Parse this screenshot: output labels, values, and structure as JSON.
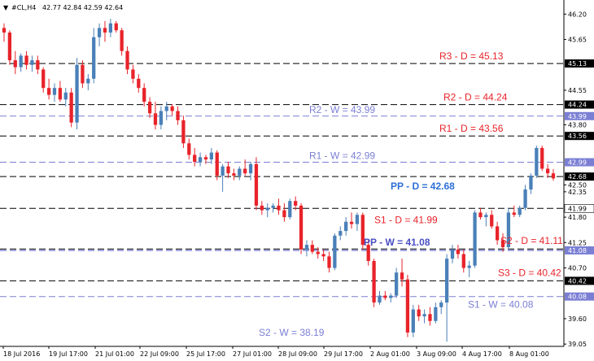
{
  "header": {
    "arrow": "▼",
    "symbol": "#CL,H4",
    "ohlc": "42.77 42.84 42.59 42.64"
  },
  "chart_data": {
    "type": "candlestick",
    "title": "#CL,H4",
    "y_ticks": [
      "46.20",
      "45.65",
      "44.55",
      "43.80",
      "42.50",
      "42.35",
      "41.80",
      "41.25",
      "40.70",
      "39.60",
      "39.05",
      "41.99",
      "41.08",
      "40.08"
    ],
    "x_ticks": [
      "18 Jul 2016",
      "19 Jul 17:00",
      "21 Jul 01:00",
      "22 Jul 09:00",
      "25 Jul 17:00",
      "27 Jul 01:00",
      "28 Jul 09:00",
      "29 Jul 17:00",
      "2 Aug 01:00",
      "3 Aug 09:00",
      "4 Aug 17:00",
      "8 Aug 01:00"
    ],
    "ylim": [
      39.0,
      46.4
    ],
    "pivot_levels": [
      {
        "label": "R3 - D = 45.13",
        "value": 45.13,
        "badge": "45.13",
        "color": "#e8232a",
        "line_color": "#000000",
        "badge_bg": "#000000",
        "badge_fg": "#ffffff",
        "bold": false
      },
      {
        "label": "R2 - D = 44.24",
        "value": 44.24,
        "badge": "44.24",
        "color": "#e8232a",
        "line_color": "#000000",
        "badge_bg": "#000000",
        "badge_fg": "#ffffff",
        "bold": false
      },
      {
        "label": "R2 - W = 43.99",
        "value": 43.99,
        "badge": "43.99",
        "color": "#7b7fd4",
        "line_color": "#7b7fd4",
        "badge_bg": "#7b7fd4",
        "badge_fg": "#ffffff",
        "bold": false
      },
      {
        "label": "R1 - D = 43.56",
        "value": 43.56,
        "badge": "43.56",
        "color": "#e8232a",
        "line_color": "#000000",
        "badge_bg": "#000000",
        "badge_fg": "#ffffff",
        "bold": false
      },
      {
        "label": "R1 - W = 42.99",
        "value": 42.99,
        "badge": "42.99",
        "color": "#7b7fd4",
        "line_color": "#7b7fd4",
        "badge_bg": "#7b7fd4",
        "badge_fg": "#ffffff",
        "bold": false
      },
      {
        "label": "PP - D = 42.68",
        "value": 42.68,
        "badge": "42.68",
        "color": "#2d6fd6",
        "line_color": "#000000",
        "badge_bg": "#000000",
        "badge_fg": "#ffffff",
        "bold": true
      },
      {
        "label": "S1 - D = 41.99",
        "value": 41.99,
        "badge": "41.99",
        "color": "#e8232a",
        "line_color": "#000000",
        "badge_bg": "#ffffff",
        "badge_fg": "#000000",
        "bold": false
      },
      {
        "label": "S2 - D = 41.11",
        "value": 41.11,
        "badge": "",
        "color": "#e8232a",
        "line_color": "#000000",
        "badge_bg": "#000000",
        "badge_fg": "#ffffff",
        "bold": false
      },
      {
        "label": "PP - W = 41.08",
        "value": 41.08,
        "badge": "41.08",
        "color": "#4a4fc4",
        "line_color": "#4a4fc4",
        "badge_bg": "#7b7fd4",
        "badge_fg": "#ffffff",
        "bold": true
      },
      {
        "label": "S3 - D = 40.42",
        "value": 40.42,
        "badge": "40.42",
        "color": "#e8232a",
        "line_color": "#000000",
        "badge_bg": "#000000",
        "badge_fg": "#ffffff",
        "bold": false
      },
      {
        "label": "S1 - W = 40.08",
        "value": 40.08,
        "badge": "40.08",
        "color": "#7b7fd4",
        "line_color": "#7b7fd4",
        "badge_bg": "#7b7fd4",
        "badge_fg": "#ffffff",
        "bold": false
      },
      {
        "label": "S2 - W = 38.19",
        "value": 38.19,
        "badge": "",
        "color": "#7b7fd4",
        "line_color": "#7b7fd4",
        "badge_bg": "",
        "badge_fg": "",
        "bold": false
      }
    ],
    "colors": {
      "bull": "#4a80b8",
      "bear": "#e8232a",
      "axis": "#000000",
      "bull_badge": "#000000"
    },
    "candles": [
      {
        "o": 45.9,
        "h": 46.0,
        "l": 45.6,
        "c": 45.8
      },
      {
        "o": 45.8,
        "h": 45.85,
        "l": 45.1,
        "c": 45.2
      },
      {
        "o": 45.2,
        "h": 45.4,
        "l": 44.9,
        "c": 45.05
      },
      {
        "o": 45.05,
        "h": 45.35,
        "l": 44.95,
        "c": 45.3
      },
      {
        "o": 45.3,
        "h": 45.4,
        "l": 45.0,
        "c": 45.1
      },
      {
        "o": 45.1,
        "h": 45.3,
        "l": 44.95,
        "c": 45.2
      },
      {
        "o": 45.2,
        "h": 45.3,
        "l": 44.9,
        "c": 45.0
      },
      {
        "o": 45.0,
        "h": 45.05,
        "l": 44.5,
        "c": 44.6
      },
      {
        "o": 44.6,
        "h": 44.8,
        "l": 44.35,
        "c": 44.45
      },
      {
        "o": 44.45,
        "h": 44.7,
        "l": 44.3,
        "c": 44.6
      },
      {
        "o": 44.6,
        "h": 44.75,
        "l": 44.3,
        "c": 44.35
      },
      {
        "o": 44.35,
        "h": 44.6,
        "l": 44.2,
        "c": 44.5
      },
      {
        "o": 44.5,
        "h": 44.6,
        "l": 43.75,
        "c": 43.85
      },
      {
        "o": 43.85,
        "h": 45.25,
        "l": 43.7,
        "c": 45.1
      },
      {
        "o": 45.1,
        "h": 45.2,
        "l": 44.6,
        "c": 44.7
      },
      {
        "o": 44.7,
        "h": 44.9,
        "l": 44.55,
        "c": 44.8
      },
      {
        "o": 44.8,
        "h": 45.9,
        "l": 44.7,
        "c": 45.7
      },
      {
        "o": 45.7,
        "h": 46.0,
        "l": 45.5,
        "c": 45.9
      },
      {
        "o": 45.9,
        "h": 46.05,
        "l": 45.6,
        "c": 45.8
      },
      {
        "o": 45.8,
        "h": 46.1,
        "l": 45.7,
        "c": 46.0
      },
      {
        "o": 46.0,
        "h": 46.05,
        "l": 45.8,
        "c": 45.85
      },
      {
        "o": 45.85,
        "h": 45.9,
        "l": 45.3,
        "c": 45.4
      },
      {
        "o": 45.4,
        "h": 45.5,
        "l": 44.9,
        "c": 45.0
      },
      {
        "o": 45.0,
        "h": 45.1,
        "l": 44.7,
        "c": 44.8
      },
      {
        "o": 44.8,
        "h": 44.9,
        "l": 44.5,
        "c": 44.6
      },
      {
        "o": 44.6,
        "h": 44.7,
        "l": 44.2,
        "c": 44.3
      },
      {
        "o": 44.3,
        "h": 44.4,
        "l": 43.95,
        "c": 44.05
      },
      {
        "o": 44.05,
        "h": 44.3,
        "l": 43.7,
        "c": 43.8
      },
      {
        "o": 43.8,
        "h": 44.2,
        "l": 43.7,
        "c": 44.1
      },
      {
        "o": 44.1,
        "h": 44.3,
        "l": 43.9,
        "c": 44.2
      },
      {
        "o": 44.2,
        "h": 44.25,
        "l": 44.0,
        "c": 44.1
      },
      {
        "o": 44.1,
        "h": 44.2,
        "l": 43.8,
        "c": 43.9
      },
      {
        "o": 43.9,
        "h": 44.0,
        "l": 43.3,
        "c": 43.4
      },
      {
        "o": 43.4,
        "h": 43.5,
        "l": 43.05,
        "c": 43.15
      },
      {
        "o": 43.15,
        "h": 43.3,
        "l": 42.9,
        "c": 43.0
      },
      {
        "o": 43.0,
        "h": 43.2,
        "l": 42.9,
        "c": 43.1
      },
      {
        "o": 43.1,
        "h": 43.15,
        "l": 42.95,
        "c": 43.05
      },
      {
        "o": 43.05,
        "h": 43.3,
        "l": 42.95,
        "c": 43.2
      },
      {
        "o": 43.2,
        "h": 43.25,
        "l": 42.6,
        "c": 42.7
      },
      {
        "o": 42.7,
        "h": 42.95,
        "l": 42.35,
        "c": 42.9
      },
      {
        "o": 42.9,
        "h": 43.0,
        "l": 42.65,
        "c": 42.75
      },
      {
        "o": 42.75,
        "h": 42.85,
        "l": 42.6,
        "c": 42.7
      },
      {
        "o": 42.7,
        "h": 42.9,
        "l": 42.6,
        "c": 42.85
      },
      {
        "o": 42.85,
        "h": 43.05,
        "l": 42.7,
        "c": 42.75
      },
      {
        "o": 42.75,
        "h": 43.0,
        "l": 42.6,
        "c": 42.95
      },
      {
        "o": 42.95,
        "h": 43.1,
        "l": 41.95,
        "c": 42.05
      },
      {
        "o": 42.05,
        "h": 42.15,
        "l": 41.85,
        "c": 41.95
      },
      {
        "o": 41.95,
        "h": 42.1,
        "l": 41.8,
        "c": 42.0
      },
      {
        "o": 42.0,
        "h": 42.1,
        "l": 41.9,
        "c": 42.05
      },
      {
        "o": 42.05,
        "h": 42.2,
        "l": 41.85,
        "c": 41.95
      },
      {
        "o": 41.95,
        "h": 42.1,
        "l": 41.7,
        "c": 41.8
      },
      {
        "o": 41.8,
        "h": 42.2,
        "l": 41.75,
        "c": 42.15
      },
      {
        "o": 42.15,
        "h": 42.25,
        "l": 41.95,
        "c": 42.05
      },
      {
        "o": 42.05,
        "h": 42.1,
        "l": 41.0,
        "c": 41.1
      },
      {
        "o": 41.1,
        "h": 41.3,
        "l": 40.95,
        "c": 41.2
      },
      {
        "o": 41.2,
        "h": 41.3,
        "l": 41.0,
        "c": 41.05
      },
      {
        "o": 41.05,
        "h": 41.15,
        "l": 40.9,
        "c": 41.0
      },
      {
        "o": 41.0,
        "h": 41.1,
        "l": 40.85,
        "c": 40.95
      },
      {
        "o": 40.95,
        "h": 41.05,
        "l": 40.6,
        "c": 40.7
      },
      {
        "o": 40.7,
        "h": 41.45,
        "l": 40.65,
        "c": 41.4
      },
      {
        "o": 41.4,
        "h": 41.6,
        "l": 41.3,
        "c": 41.5
      },
      {
        "o": 41.5,
        "h": 41.8,
        "l": 41.4,
        "c": 41.7
      },
      {
        "o": 41.7,
        "h": 41.9,
        "l": 41.55,
        "c": 41.65
      },
      {
        "o": 41.65,
        "h": 41.9,
        "l": 41.5,
        "c": 41.85
      },
      {
        "o": 41.85,
        "h": 41.9,
        "l": 41.1,
        "c": 41.2
      },
      {
        "o": 41.2,
        "h": 41.3,
        "l": 40.75,
        "c": 40.85
      },
      {
        "o": 40.85,
        "h": 40.9,
        "l": 39.85,
        "c": 39.95
      },
      {
        "o": 39.95,
        "h": 40.2,
        "l": 39.9,
        "c": 40.1
      },
      {
        "o": 40.1,
        "h": 40.2,
        "l": 40.0,
        "c": 40.05
      },
      {
        "o": 40.05,
        "h": 40.15,
        "l": 39.95,
        "c": 40.1
      },
      {
        "o": 40.1,
        "h": 40.7,
        "l": 40.05,
        "c": 40.6
      },
      {
        "o": 40.6,
        "h": 40.9,
        "l": 40.3,
        "c": 40.45
      },
      {
        "o": 40.45,
        "h": 40.55,
        "l": 39.2,
        "c": 39.3
      },
      {
        "o": 39.3,
        "h": 39.9,
        "l": 39.2,
        "c": 39.8
      },
      {
        "o": 39.8,
        "h": 39.9,
        "l": 39.55,
        "c": 39.65
      },
      {
        "o": 39.65,
        "h": 39.8,
        "l": 39.5,
        "c": 39.7
      },
      {
        "o": 39.7,
        "h": 39.85,
        "l": 39.45,
        "c": 39.55
      },
      {
        "o": 39.55,
        "h": 39.95,
        "l": 39.5,
        "c": 39.85
      },
      {
        "o": 39.85,
        "h": 40.0,
        "l": 39.7,
        "c": 39.95
      },
      {
        "o": 39.95,
        "h": 41.0,
        "l": 39.1,
        "c": 40.9
      },
      {
        "o": 40.9,
        "h": 41.2,
        "l": 40.8,
        "c": 41.1
      },
      {
        "o": 41.1,
        "h": 41.2,
        "l": 40.9,
        "c": 41.0
      },
      {
        "o": 41.0,
        "h": 41.1,
        "l": 40.6,
        "c": 40.7
      },
      {
        "o": 40.7,
        "h": 40.85,
        "l": 40.5,
        "c": 40.75
      },
      {
        "o": 40.75,
        "h": 41.95,
        "l": 40.7,
        "c": 41.9
      },
      {
        "o": 41.9,
        "h": 42.0,
        "l": 41.75,
        "c": 41.8
      },
      {
        "o": 41.8,
        "h": 41.9,
        "l": 41.6,
        "c": 41.85
      },
      {
        "o": 41.85,
        "h": 41.95,
        "l": 41.55,
        "c": 41.6
      },
      {
        "o": 41.6,
        "h": 41.7,
        "l": 41.2,
        "c": 41.3
      },
      {
        "o": 41.3,
        "h": 41.45,
        "l": 41.05,
        "c": 41.15
      },
      {
        "o": 41.15,
        "h": 42.0,
        "l": 41.1,
        "c": 41.9
      },
      {
        "o": 41.9,
        "h": 42.05,
        "l": 41.8,
        "c": 41.85
      },
      {
        "o": 41.85,
        "h": 42.05,
        "l": 41.8,
        "c": 42.0
      },
      {
        "o": 42.0,
        "h": 42.5,
        "l": 41.95,
        "c": 42.4
      },
      {
        "o": 42.4,
        "h": 42.75,
        "l": 42.3,
        "c": 42.7
      },
      {
        "o": 42.7,
        "h": 43.35,
        "l": 42.65,
        "c": 43.3
      },
      {
        "o": 43.3,
        "h": 43.35,
        "l": 42.8,
        "c": 42.85
      },
      {
        "o": 42.85,
        "h": 42.95,
        "l": 42.65,
        "c": 42.75
      },
      {
        "o": 42.75,
        "h": 42.84,
        "l": 42.59,
        "c": 42.64
      }
    ]
  }
}
